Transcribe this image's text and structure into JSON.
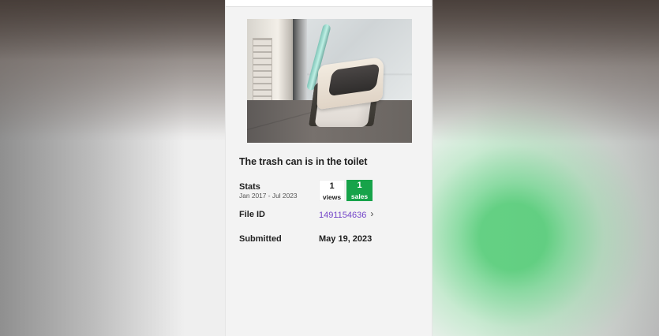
{
  "asset": {
    "title": "The trash can is in the toilet",
    "image_description": "",
    "stats": {
      "label": "Stats",
      "date_range": "Jan 2017 - Jul 2023",
      "views": {
        "value": "1",
        "label": "views"
      },
      "sales": {
        "value": "1",
        "label": "sales",
        "color": "#17a34a"
      }
    },
    "file_id": {
      "label": "File ID",
      "value": "1491154636",
      "icon": "chevron-right-icon",
      "link_color": "#7344c8"
    },
    "submitted": {
      "label": "Submitted",
      "value": "May 19, 2023"
    }
  }
}
